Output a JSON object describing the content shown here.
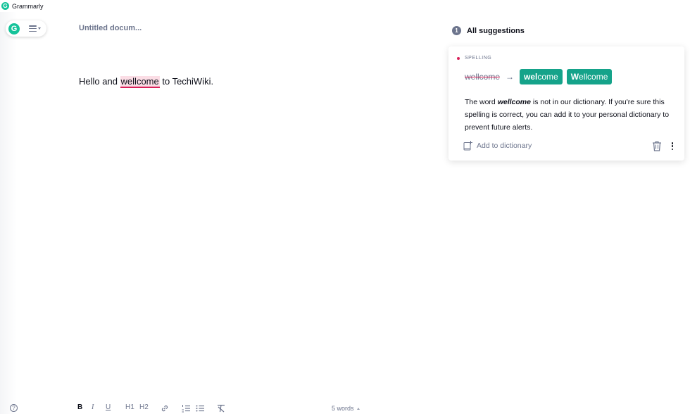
{
  "app": {
    "title": "Grammarly",
    "logo_letter": "G"
  },
  "document": {
    "title": "Untitled docum...",
    "text_before": "Hello and ",
    "flagged_word": "wellcome",
    "text_after": " to TechiWiki."
  },
  "suggestions": {
    "count": "1",
    "header": "All suggestions",
    "card": {
      "category": "SPELLING",
      "original": "wellcome",
      "arrow": "→",
      "options": [
        {
          "bold": "wel",
          "rest": "come"
        },
        {
          "bold": "W",
          "rest": "ellcome"
        }
      ],
      "explanation_pre": "The word ",
      "explanation_word": "wellcome",
      "explanation_post": " is not in our dictionary. If you're sure this spelling is correct, you can add it to your personal dictionary to prevent future alerts.",
      "add_to_dictionary": "Add to dictionary"
    }
  },
  "footer": {
    "help": "?",
    "bold": "B",
    "italic": "I",
    "underline": "U",
    "h1": "H1",
    "h2": "H2",
    "word_count": "5 words"
  },
  "icons": {
    "logo": "grammarly-g-icon",
    "menu": "hamburger-menu-icon",
    "dictionary": "book-plus-icon",
    "trash": "trash-icon",
    "more": "kebab-icon",
    "link": "link-icon",
    "ordered_list": "ordered-list-icon",
    "bullet_list": "bullet-list-icon",
    "clear_format": "clear-format-icon"
  },
  "colors": {
    "brand": "#15c39a",
    "chip": "#15a38a",
    "error": "#d9225a",
    "highlight": "#fbdde5",
    "muted": "#6d758d"
  }
}
